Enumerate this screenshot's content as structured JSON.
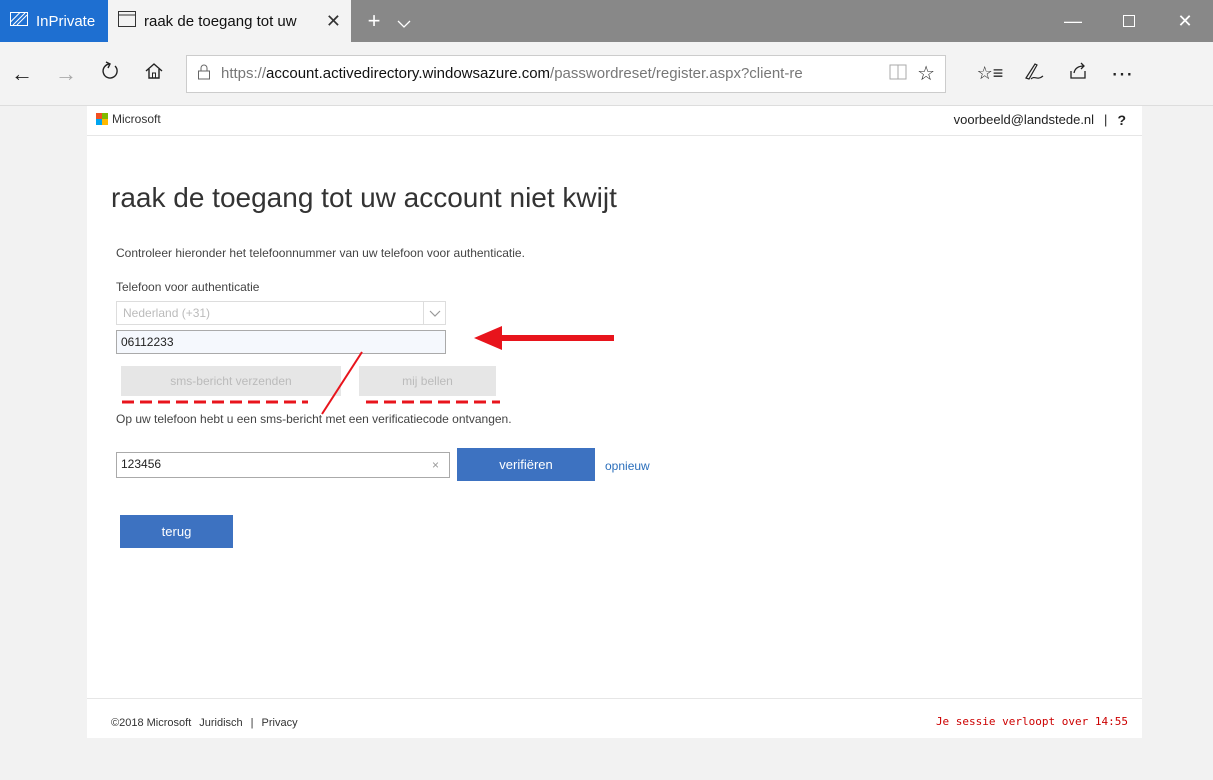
{
  "browser": {
    "inprivate_label": "InPrivate",
    "tab_title": "raak de toegang tot uw",
    "new_tab_icon": "plus-icon",
    "url_scheme": "https://",
    "url_host": "account.activedirectory.windowsazure.com",
    "url_path": "/passwordreset/register.aspx?client-re"
  },
  "header": {
    "brand": "Microsoft",
    "user_email": "voorbeeld@landstede.nl",
    "separator": "|",
    "help": "?"
  },
  "main": {
    "title": "raak de toegang tot uw account niet kwijt",
    "instruction": "Controleer hieronder het telefoonnummer van uw telefoon voor authenticatie.",
    "phone_label": "Telefoon voor authenticatie",
    "country_value": "Nederland (+31)",
    "phone_value": "06112233",
    "sms_button": "sms-bericht verzenden",
    "call_button": "mij bellen",
    "sms_info": "Op uw telefoon hebt u een sms-bericht met een verificatiecode ontvangen.",
    "code_value": "123456",
    "clear_symbol": "×",
    "verify_button": "verifiëren",
    "again_link": "opnieuw",
    "back_button": "terug"
  },
  "footer": {
    "copyright": "©2018 Microsoft",
    "legal": "Juridisch",
    "separator": "|",
    "privacy": "Privacy",
    "session": "Je sessie verloopt over 14:55"
  },
  "colors": {
    "inprivate": "#1e6fd1",
    "primary_button": "#3d72c1",
    "link": "#2a6ebb",
    "annotation": "#e8141c"
  }
}
